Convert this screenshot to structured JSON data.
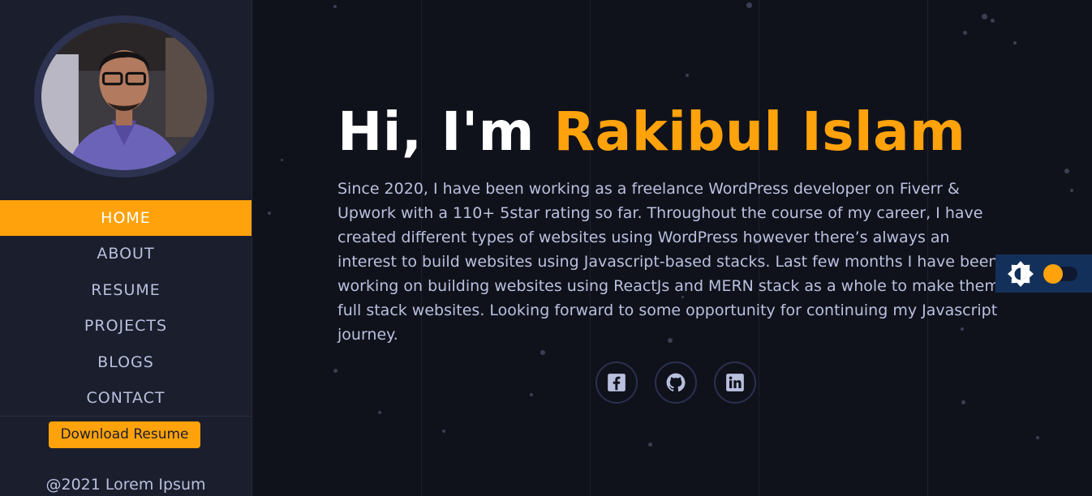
{
  "sidebar": {
    "nav": [
      {
        "label": "HOME",
        "active": true
      },
      {
        "label": "ABOUT",
        "active": false
      },
      {
        "label": "RESUME",
        "active": false
      },
      {
        "label": "PROJECTS",
        "active": false
      },
      {
        "label": "BLOGS",
        "active": false
      },
      {
        "label": "CONTACT",
        "active": false
      }
    ],
    "download_label": "Download Resume",
    "copyright": "@2021 Lorem Ipsum"
  },
  "hero": {
    "greeting": "Hi, I'm",
    "name": "Rakibul Islam",
    "bio": "Since 2020, I have been working as a freelance WordPress developer on Fiverr & Upwork with a 110+ 5star rating so far. Throughout the course of my career, I have created different types of websites using WordPress however there’s always an interest to build websites using Javascript-based stacks. Last few months I have been working on building websites using ReactJs and MERN stack as a whole to make them full stack websites. Looking forward to some opportunity for continuing my Javascript journey."
  },
  "socials": [
    {
      "icon": "facebook-icon"
    },
    {
      "icon": "github-icon"
    },
    {
      "icon": "linkedin-icon"
    }
  ],
  "theme_toggle": {
    "icon": "brightness-icon",
    "state": "dark"
  },
  "colors": {
    "accent": "#ffa20b",
    "sidebar_bg": "#1b1e2c",
    "main_bg": "#10121b",
    "text_muted": "#b9c0de",
    "toggle_bg": "#13305a"
  }
}
